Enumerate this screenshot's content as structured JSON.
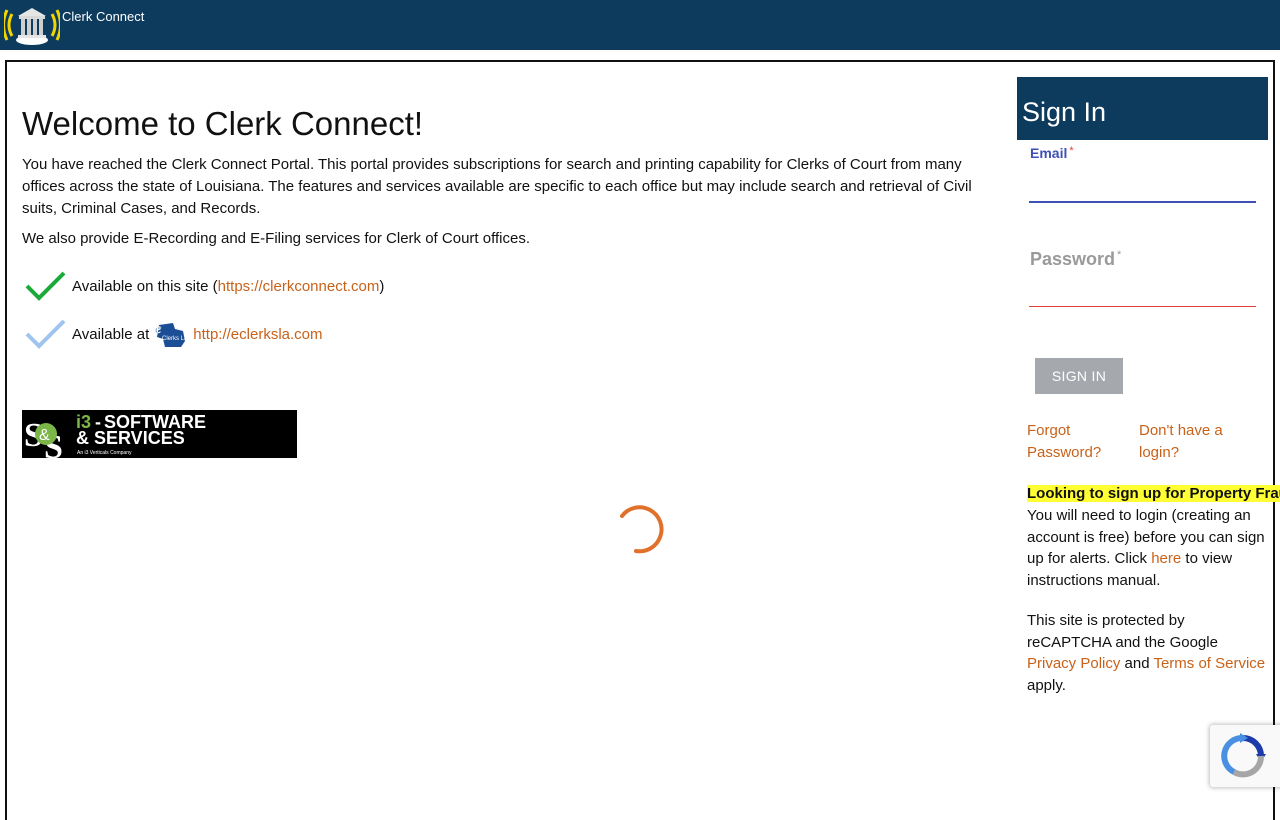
{
  "header": {
    "title": "Clerk Connect",
    "logo_icon": "courthouse-signal-icon",
    "bg_color": "#0d3b5e"
  },
  "main": {
    "heading": "Welcome to Clerk Connect!",
    "intro": "You have reached the Clerk Connect Portal. This portal provides subscriptions for search and printing capability for Clerks of Court from many offices across the state of Louisiana. The features and services available are specific to each office but may include search and retrieval of Civil suits, Criminal Cases, and Records.",
    "services": "We also provide E-Recording and E-Filing services for Clerk of Court offices.",
    "legend": [
      {
        "label": "Available on this site (",
        "link": "https://clerkconnect.com",
        "suffix": ")",
        "icon": "green-check-icon",
        "color": "#1aaa3a"
      },
      {
        "label": "Available at",
        "link": "http://eclerksla.com",
        "suffix": "",
        "icon": "light-blue-check-icon",
        "color": "#9ec5ef"
      }
    ],
    "vendor_logo_icon": "i3-software-services-logo",
    "vendor_logo_text": [
      "i3",
      "SOFTWARE",
      "& SERVICES",
      "An i3 Verticals Company"
    ],
    "eclerks_logo_icon": "eclerks-la-logo",
    "eclerks_logo_text": "Clerks LA",
    "spinner_icon": "loading-spinner-icon",
    "accent_color": "#e0702a"
  },
  "signin": {
    "title": "Sign In",
    "email_label": "Email",
    "password_label": "Password",
    "required_mark": "*",
    "email_value": "",
    "password_value": "",
    "button_label": "SIGN IN",
    "forgot_link": "Forgot Password?",
    "register_link": "Don't have a login?",
    "alert_highlight": "Looking to sign up for Property Fraud Alerts?",
    "alert_text_before": "You will need to login (creating an account is free) before you can sign up for alerts. Click ",
    "alert_link": "here",
    "alert_text_after": " to view instructions manual.",
    "recaptcha_before": "This site is protected by reCAPTCHA and the Google ",
    "privacy_link": "Privacy Policy",
    "recaptcha_and": " and ",
    "terms_link": "Terms of Service",
    "recaptcha_after": " apply.",
    "link_color": "#c8621a"
  },
  "recaptcha_badge": {
    "icon": "recaptcha-icon"
  }
}
